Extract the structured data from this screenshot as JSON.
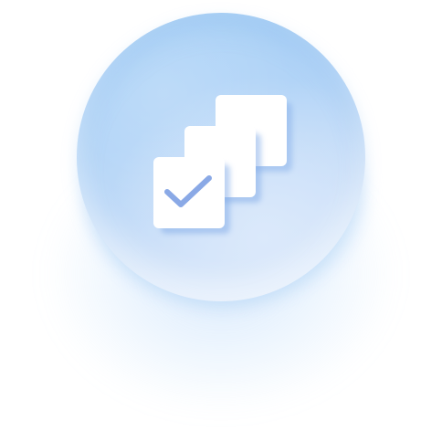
{
  "illustration": {
    "icon_name": "stacked-checkbox-cards-icon",
    "colors": {
      "background": "#ffffff",
      "orb_top": "#a6d0f6",
      "orb_bottom": "#e4eefb",
      "card_fill": "#ffffff",
      "card_shadow": "#8fb8ec",
      "check_mark": "#8aa9e6"
    }
  }
}
